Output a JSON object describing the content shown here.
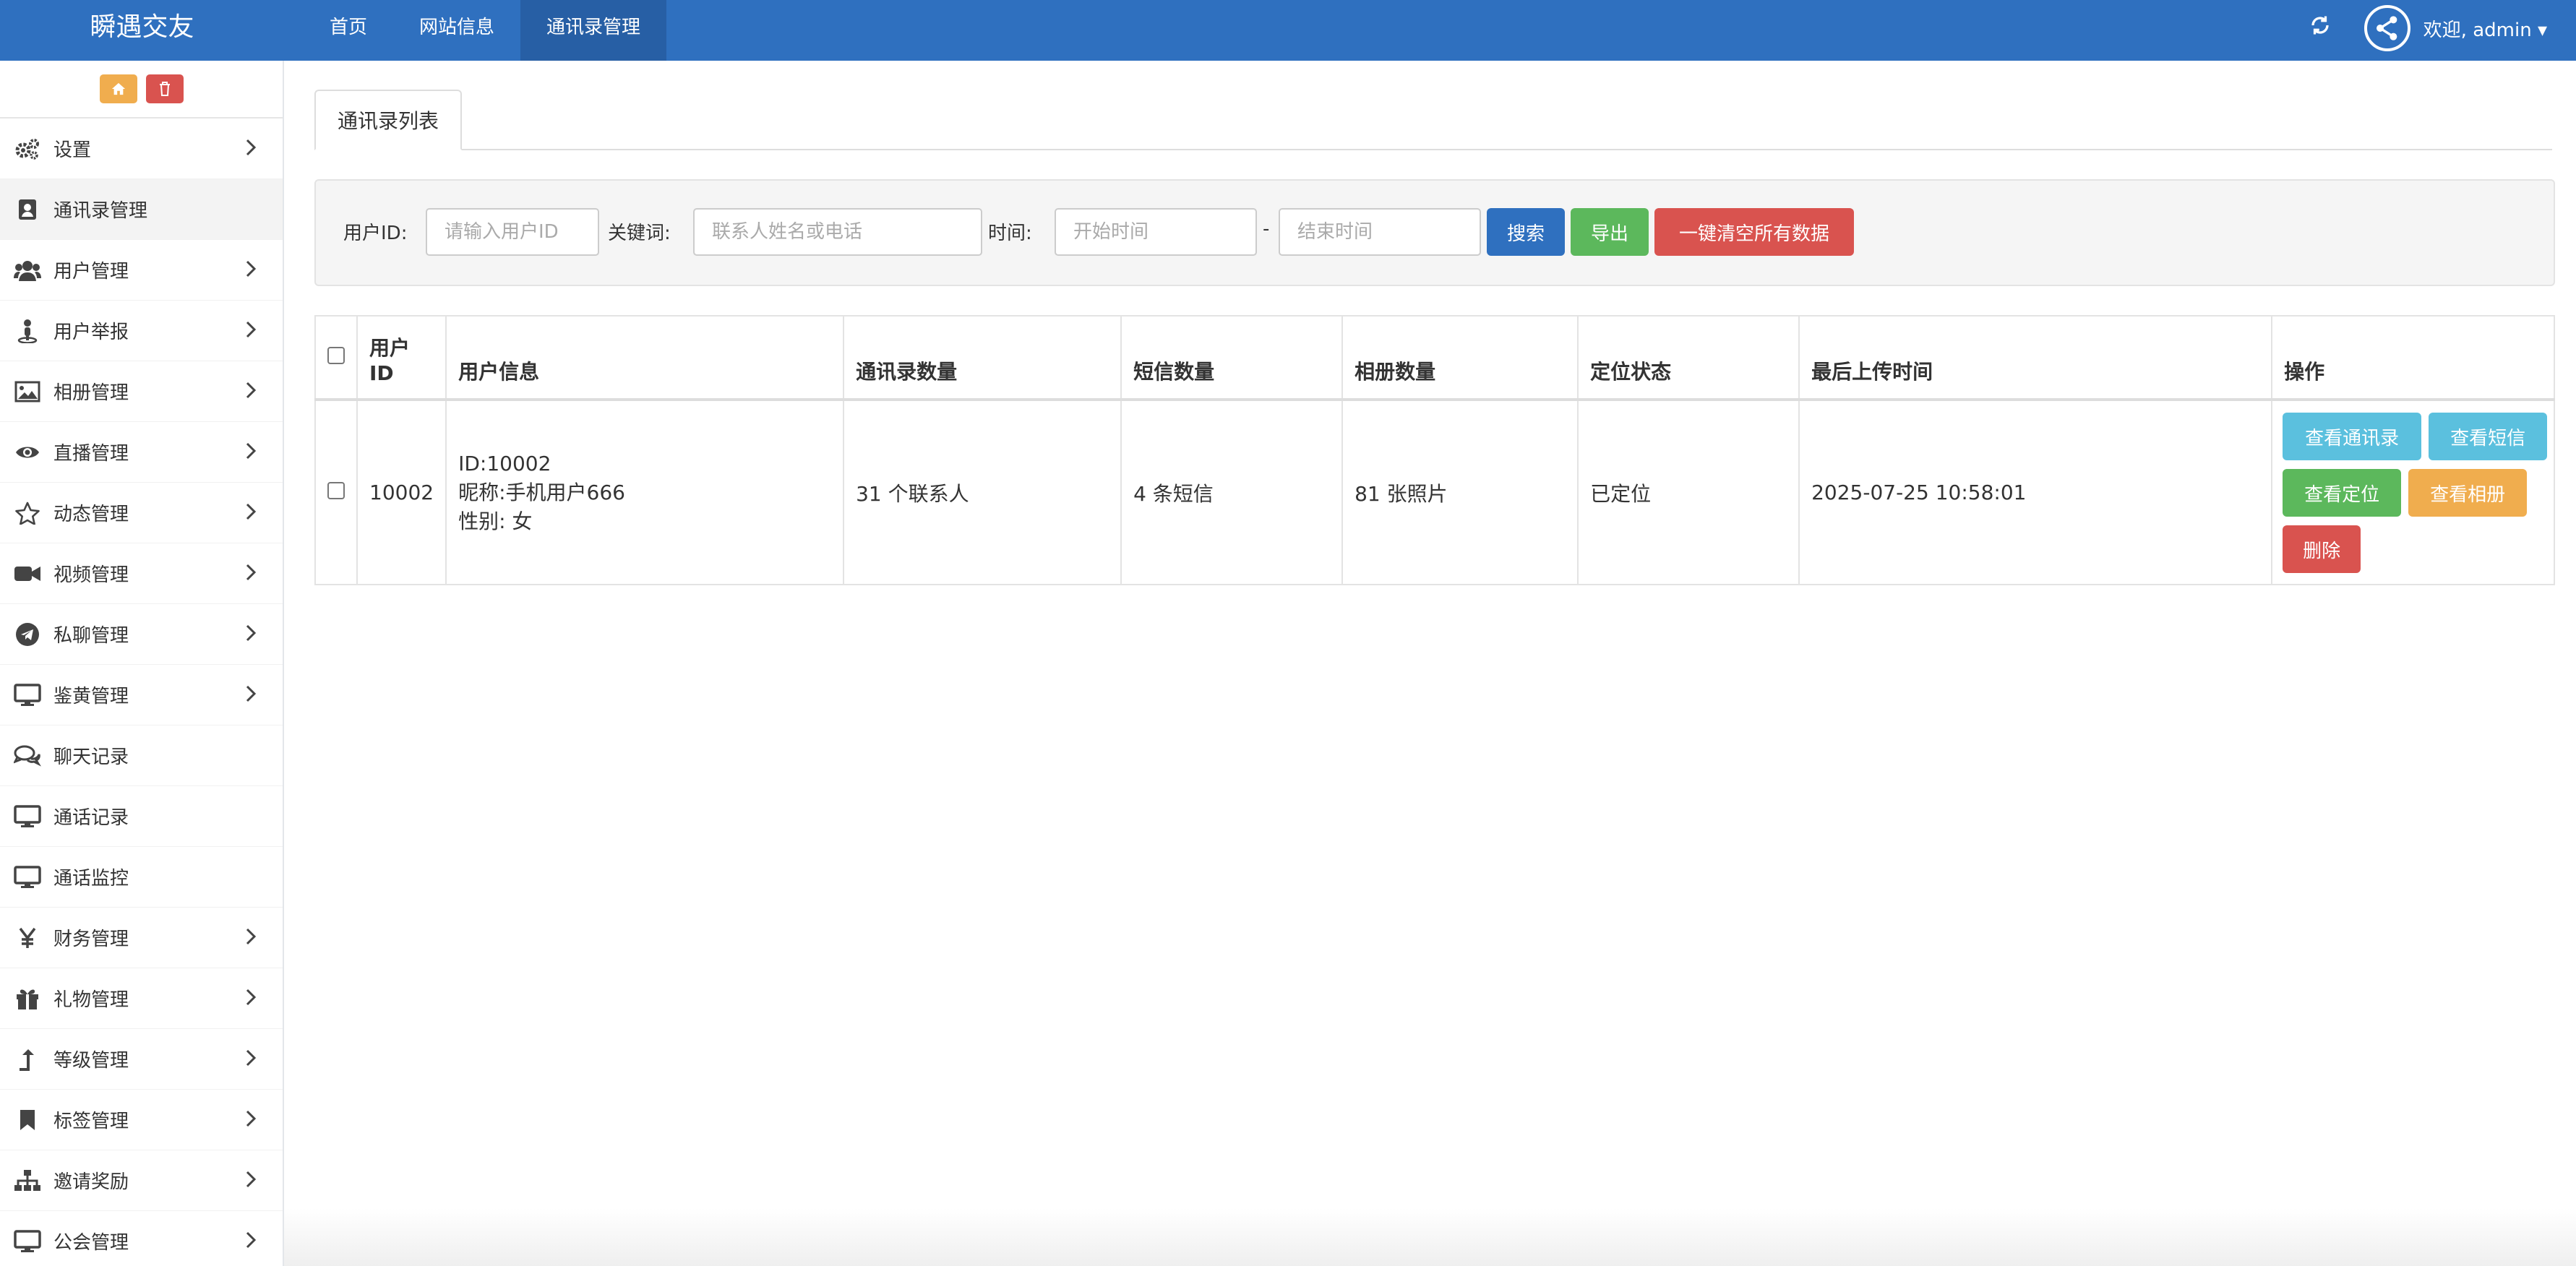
{
  "app": {
    "brand": "瞬遇交友",
    "top_nav": [
      {
        "label": "首页",
        "active": false
      },
      {
        "label": "网站信息",
        "active": false
      },
      {
        "label": "通讯录管理",
        "active": true
      }
    ],
    "welcome": "欢迎, admin",
    "accent_color": "#2f70bf"
  },
  "sidebar": {
    "items": [
      {
        "label": "设置",
        "icon": "gears-icon",
        "has_arrow": true,
        "active": false
      },
      {
        "label": "通讯录管理",
        "icon": "address-book-icon",
        "has_arrow": false,
        "active": true
      },
      {
        "label": "用户管理",
        "icon": "users-icon",
        "has_arrow": true,
        "active": false
      },
      {
        "label": "用户举报",
        "icon": "report-user-icon",
        "has_arrow": true,
        "active": false
      },
      {
        "label": "相册管理",
        "icon": "image-icon",
        "has_arrow": true,
        "active": false
      },
      {
        "label": "直播管理",
        "icon": "eye-icon",
        "has_arrow": true,
        "active": false
      },
      {
        "label": "动态管理",
        "icon": "star-icon",
        "has_arrow": true,
        "active": false
      },
      {
        "label": "视频管理",
        "icon": "video-camera-icon",
        "has_arrow": true,
        "active": false
      },
      {
        "label": "私聊管理",
        "icon": "telegram-icon",
        "has_arrow": true,
        "active": false
      },
      {
        "label": "鉴黄管理",
        "icon": "desktop-icon",
        "has_arrow": true,
        "active": false
      },
      {
        "label": "聊天记录",
        "icon": "comments-icon",
        "has_arrow": false,
        "active": false
      },
      {
        "label": "通话记录",
        "icon": "desktop-icon",
        "has_arrow": false,
        "active": false
      },
      {
        "label": "通话监控",
        "icon": "desktop-icon",
        "has_arrow": false,
        "active": false
      },
      {
        "label": "财务管理",
        "icon": "yen-icon",
        "has_arrow": true,
        "active": false
      },
      {
        "label": "礼物管理",
        "icon": "gift-icon",
        "has_arrow": true,
        "active": false
      },
      {
        "label": "等级管理",
        "icon": "level-up-icon",
        "has_arrow": true,
        "active": false
      },
      {
        "label": "标签管理",
        "icon": "bookmark-icon",
        "has_arrow": true,
        "active": false
      },
      {
        "label": "邀请奖励",
        "icon": "sitemap-icon",
        "has_arrow": true,
        "active": false
      },
      {
        "label": "公会管理",
        "icon": "desktop-icon",
        "has_arrow": true,
        "active": false
      }
    ]
  },
  "main": {
    "tab_label": "通讯录列表",
    "search": {
      "user_id_label": "用户ID:",
      "user_id_placeholder": "请输入用户ID",
      "keyword_label": "关键词:",
      "keyword_placeholder": "联系人姓名或电话",
      "time_label": "时间:",
      "start_placeholder": "开始时间",
      "separator": "-",
      "end_placeholder": "结束时间",
      "search_btn": "搜索",
      "export_btn": "导出",
      "clear_btn": "一键清空所有数据"
    },
    "table": {
      "headers": [
        "用户\nID",
        "用户信息",
        "通讯录数量",
        "短信数量",
        "相册数量",
        "定位状态",
        "最后上传时间",
        "操作"
      ],
      "header_user_id_line1": "用户",
      "header_user_id_line2": "ID",
      "rows": [
        {
          "user_id": "10002",
          "info_id": "ID:10002",
          "info_nick": "昵称:手机用户666",
          "info_gender": "性别: 女",
          "contacts": "31 个联系人",
          "sms": "4 条短信",
          "photos": "81 张照片",
          "location": "已定位",
          "last_upload": "2025-07-25 10:58:01",
          "actions": {
            "view_contacts": "查看通讯录",
            "view_sms": "查看短信",
            "view_location": "查看定位",
            "view_album": "查看相册",
            "delete": "删除"
          }
        }
      ]
    }
  }
}
